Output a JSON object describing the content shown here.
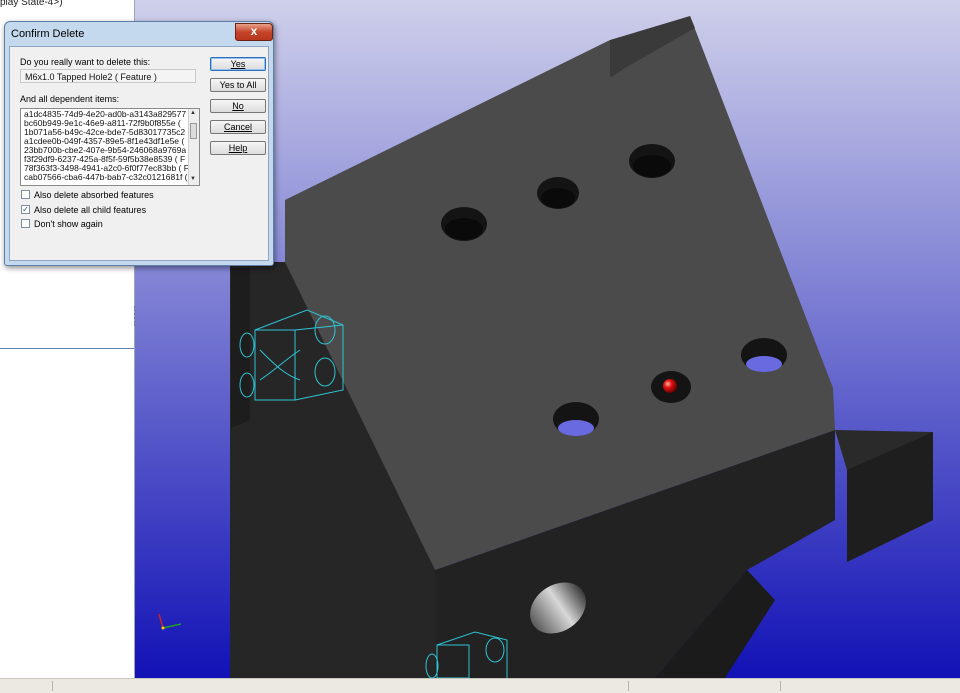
{
  "feature_tree": {
    "top_text": "play State-4>)"
  },
  "dialog": {
    "title": "Confirm Delete",
    "close_glyph": "x",
    "question": "Do you really want to delete this:",
    "feature_name": "M6x1.0 Tapped Hole2 ( Feature )",
    "dependents_label": "And all dependent items:",
    "dependent_items": [
      "a1dc4835-74d9-4e20-ad0b-a3143a829577",
      "bc60b949-9e1c-46e9-a811-72f9b0f855e (",
      "1b071a56-b49c-42ce-bde7-5d83017735c2 (",
      "a1cdee0b-049f-4357-89e5-8f1e43df1e5e (",
      "23bb700b-cbe2-407e-9b54-246068a9769a",
      "f3f29df9-6237-425a-8f5f-59f5b38e8539 ( F",
      "78f363f3-3498-4941-a2c0-6f0f77ec83bb ( F",
      "cab07566-cba6-447b-bab7-c32c0121681f ("
    ],
    "buttons": {
      "yes": "Yes",
      "yes_to_all": "Yes to All",
      "no": "No",
      "cancel": "Cancel",
      "help": "Help"
    },
    "checkboxes": [
      {
        "label": "Also delete absorbed features",
        "checked": false
      },
      {
        "label": "Also delete all child features",
        "checked": true
      },
      {
        "label": "Don't show again",
        "checked": false
      }
    ]
  },
  "colors": {
    "viewport_top": "#c9cbe6",
    "viewport_bottom": "#1614b8",
    "part_top_face": "#4a4a4a",
    "part_side_face": "#232323",
    "selection_marker": "#e01010",
    "wire_edges": "#2ec4d4"
  }
}
